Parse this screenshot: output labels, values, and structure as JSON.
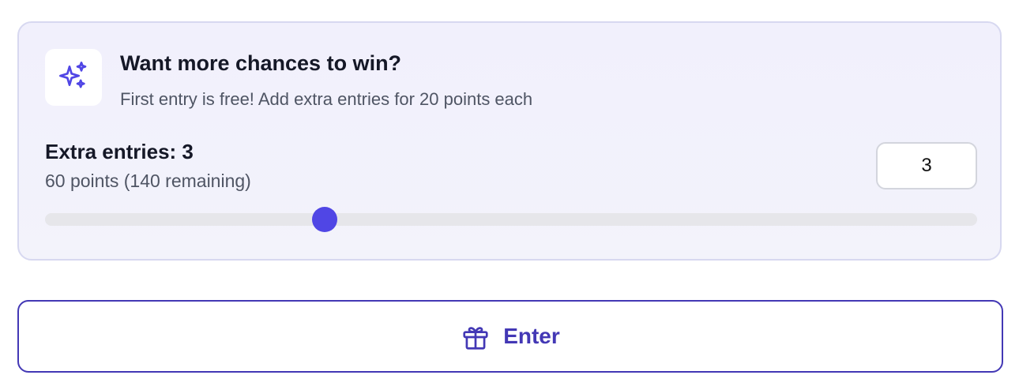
{
  "promo": {
    "icon": "sparkles-icon",
    "title": "Want more chances to win?",
    "subtitle": "First entry is free! Add extra entries for 20 points each"
  },
  "entries": {
    "label": "Extra entries: 3",
    "points_text": "60 points (140 remaining)",
    "input_value": "3",
    "slider_value": 3,
    "slider_min": 0,
    "slider_max": 10
  },
  "enter_button": {
    "icon": "gift-icon",
    "label": "Enter"
  },
  "colors": {
    "accent": "#5046e5",
    "button_text": "#4338b5",
    "card_border": "#d7d8f0",
    "track": "#e6e6ea"
  }
}
